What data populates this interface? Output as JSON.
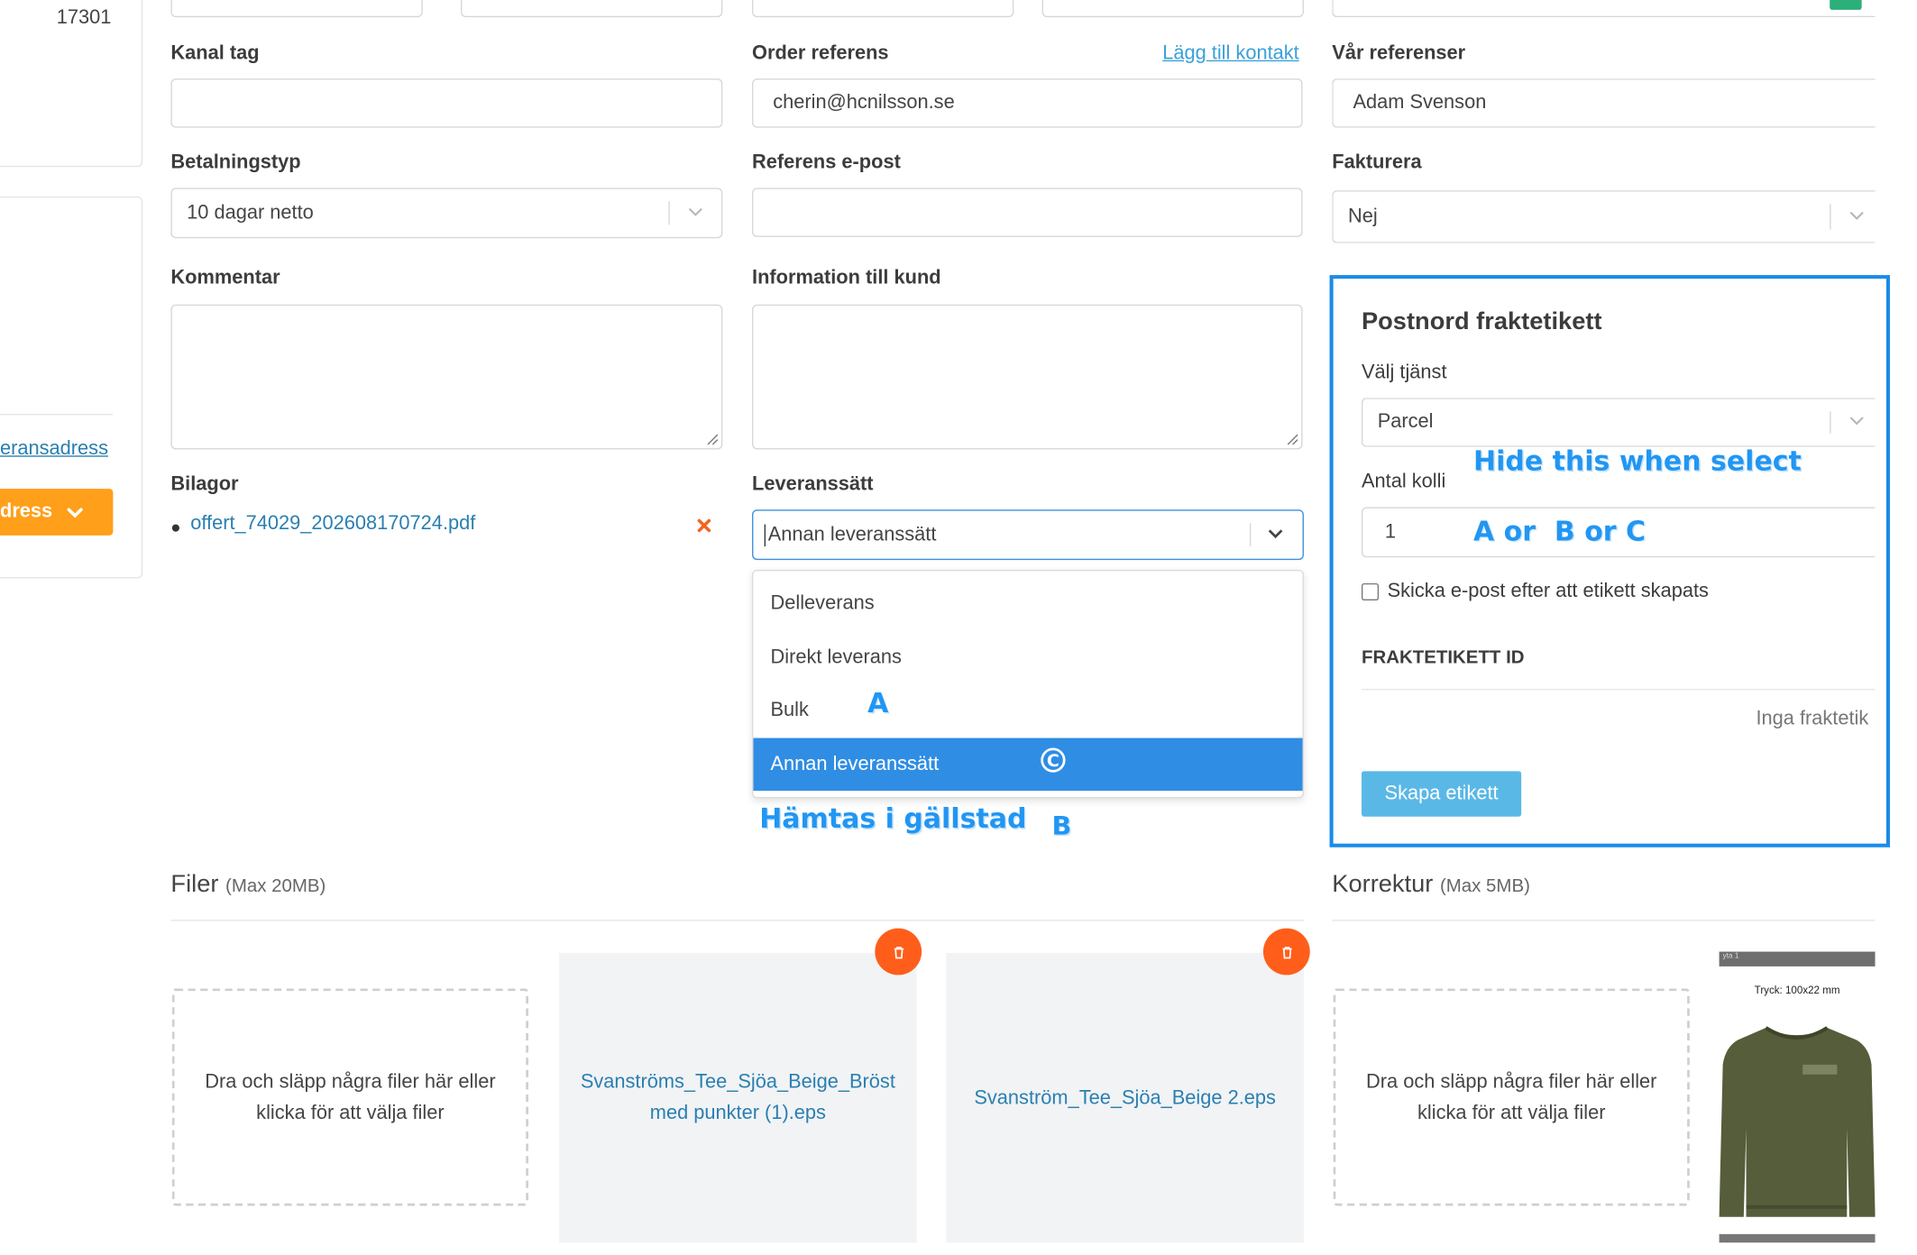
{
  "left_partial": {
    "number": "17301",
    "address_link": "eransadress",
    "address_button": "dress"
  },
  "form": {
    "kanal_tag": {
      "label": "Kanal tag",
      "value": ""
    },
    "order_referens": {
      "label": "Order referens",
      "add_contact_link": "Lägg till kontakt",
      "value": "cherin@hcnilsson.se"
    },
    "var_referenser": {
      "label": "Vår referenser",
      "value": "Adam Svenson"
    },
    "betalningstyp": {
      "label": "Betalningstyp",
      "value": "10 dagar netto"
    },
    "referens_epost": {
      "label": "Referens e-post",
      "value": ""
    },
    "fakturera": {
      "label": "Fakturera",
      "value": "Nej"
    },
    "kommentar": {
      "label": "Kommentar"
    },
    "information_till_kund": {
      "label": "Information till kund"
    },
    "bilagor": {
      "label": "Bilagor",
      "file": "offert_74029_202608170724.pdf"
    },
    "leveranssatt": {
      "label": "Leveranssätt",
      "value": "Annan leveranssätt",
      "options": [
        "Delleverans",
        "Direkt leverans",
        "Bulk",
        "Annan leveranssätt"
      ],
      "selected_index": 3
    }
  },
  "postnord": {
    "title": "Postnord fraktetikett",
    "service_label": "Välj tjänst",
    "service_value": "Parcel",
    "kolli_label": "Antal kolli",
    "kolli_value": "1",
    "email_checkbox_label": "Skicka e-post efter att etikett skapats",
    "email_checked": false,
    "id_header": "FRAKTETIKETT ID",
    "empty_text": "Inga fraktetik",
    "create_button": "Skapa etikett"
  },
  "annotations": {
    "hide_line1": "Hide this when select",
    "hide_line2": "A or  B or C",
    "mark_a": "A",
    "mark_c": "C",
    "hamtas": "Hämtas i gällstad",
    "mark_b": "B"
  },
  "files": {
    "title": "Filer",
    "max": "(Max 20MB)",
    "dropzone_text": "Dra och släpp några filer här eller klicka för att välja filer",
    "items": [
      "Svanströms_Tee_Sjöa_Beige_Bröst med punkter (1).eps",
      "Svanström_Tee_Sjöa_Beige 2.eps"
    ]
  },
  "korrektur": {
    "title": "Korrektur",
    "max": "(Max 5MB)",
    "dropzone_text": "Dra och släpp några filer här eller klicka för att välja filer",
    "preview_header": "yta 1",
    "preview_caption": "Tryck: 100x22 mm"
  },
  "colors": {
    "accent_blue": "#3b8fdd",
    "selected_blue": "#2f8de4",
    "highlight_border": "#1a8ce8",
    "orange": "#ff9f1a",
    "delete_orange": "#ff5e1a",
    "create_button": "#5ab8e6"
  }
}
